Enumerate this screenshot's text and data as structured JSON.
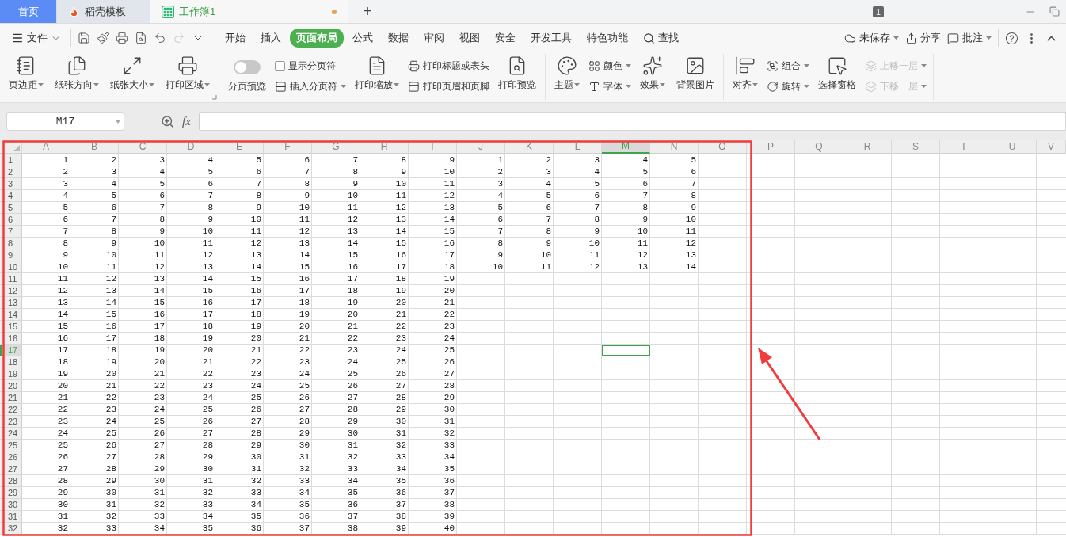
{
  "title_bar": {
    "tabs": [
      {
        "kind": "home",
        "label": "首页",
        "selected": false
      },
      {
        "kind": "docer",
        "label": "稻壳模板",
        "selected": false
      },
      {
        "kind": "sheet",
        "label": "工作簿1",
        "selected": true,
        "unsaved": true
      }
    ],
    "new_tab": "+",
    "window_count": "1"
  },
  "menu_bar": {
    "file_menu": "文件",
    "quick_actions": [
      {
        "disabled": false
      },
      {
        "disabled": false
      },
      {
        "disabled": false
      },
      {
        "disabled": false
      },
      {
        "disabled": false
      },
      {
        "disabled": true
      },
      {
        "disabled": false
      }
    ],
    "tabs": [
      {
        "label": "开始",
        "selected": false
      },
      {
        "label": "插入",
        "selected": false
      },
      {
        "label": "页面布局",
        "selected": true
      },
      {
        "label": "公式",
        "selected": false
      },
      {
        "label": "数据",
        "selected": false
      },
      {
        "label": "审阅",
        "selected": false
      },
      {
        "label": "视图",
        "selected": false
      },
      {
        "label": "安全",
        "selected": false
      },
      {
        "label": "开发工具",
        "selected": false
      },
      {
        "label": "特色功能",
        "selected": false
      }
    ],
    "search": "查找",
    "right_actions": [
      {
        "label": "未保存",
        "dropdown": true
      },
      {
        "label": "分享",
        "dropdown": false
      },
      {
        "label": "批注",
        "dropdown": true
      }
    ]
  },
  "ribbon": {
    "groups": [
      {
        "items": [
          {
            "kind": "large",
            "label": "页边距",
            "dropdown": true
          },
          {
            "kind": "large",
            "label": "纸张方向",
            "dropdown": true
          },
          {
            "kind": "large",
            "label": "纸张大小",
            "dropdown": true
          },
          {
            "kind": "large",
            "label": "打印区域",
            "dropdown": true
          }
        ]
      },
      {
        "items": [
          {
            "kind": "toggle",
            "label": "分页预览",
            "on": false
          },
          {
            "kind": "stack",
            "items": [
              {
                "kind": "checkbox",
                "label": "显示分页符",
                "checked": false
              },
              {
                "kind": "small",
                "label": "插入分页符",
                "dropdown": true,
                "disabled": false
              }
            ]
          },
          {
            "kind": "large",
            "label": "打印缩放",
            "dropdown": true
          },
          {
            "kind": "stack",
            "items": [
              {
                "kind": "small",
                "label": "打印标题或表头",
                "dropdown": false,
                "disabled": false
              },
              {
                "kind": "small",
                "label": "打印页眉和页脚",
                "dropdown": false,
                "disabled": false
              }
            ]
          },
          {
            "kind": "large",
            "label": "打印预览",
            "dropdown": false
          }
        ]
      },
      {
        "items": [
          {
            "kind": "large",
            "label": "主题",
            "dropdown": true
          },
          {
            "kind": "stack",
            "items": [
              {
                "kind": "small",
                "label": "颜色",
                "dropdown": true,
                "disabled": false
              },
              {
                "kind": "small",
                "label": "字体",
                "dropdown": true,
                "disabled": false
              }
            ]
          },
          {
            "kind": "large",
            "label": "效果",
            "dropdown": true
          },
          {
            "kind": "large",
            "label": "背景图片",
            "dropdown": false
          }
        ]
      },
      {
        "items": [
          {
            "kind": "large",
            "label": "对齐",
            "dropdown": true
          },
          {
            "kind": "stack",
            "items": [
              {
                "kind": "small",
                "label": "组合",
                "dropdown": true,
                "disabled": false
              },
              {
                "kind": "small",
                "label": "旋转",
                "dropdown": true,
                "disabled": false
              }
            ]
          },
          {
            "kind": "large",
            "label": "选择窗格",
            "dropdown": false
          },
          {
            "kind": "stack",
            "items": [
              {
                "kind": "small",
                "label": "上移一层",
                "dropdown": true,
                "disabled": true
              },
              {
                "kind": "small",
                "label": "下移一层",
                "dropdown": true,
                "disabled": true
              }
            ]
          }
        ]
      }
    ]
  },
  "formula_bar": {
    "name_box": "M17",
    "fx": "fx"
  },
  "sheet": {
    "columns": [
      {
        "label": "A",
        "selected": false
      },
      {
        "label": "B",
        "selected": false
      },
      {
        "label": "C",
        "selected": false
      },
      {
        "label": "D",
        "selected": false
      },
      {
        "label": "E",
        "selected": false
      },
      {
        "label": "F",
        "selected": false
      },
      {
        "label": "G",
        "selected": false
      },
      {
        "label": "H",
        "selected": false
      },
      {
        "label": "I",
        "selected": false
      },
      {
        "label": "J",
        "selected": false
      },
      {
        "label": "K",
        "selected": false
      },
      {
        "label": "L",
        "selected": false
      },
      {
        "label": "M",
        "selected": true
      },
      {
        "label": "N",
        "selected": false
      },
      {
        "label": "O",
        "selected": false
      },
      {
        "label": "P",
        "selected": false
      },
      {
        "label": "Q",
        "selected": false
      },
      {
        "label": "R",
        "selected": false
      },
      {
        "label": "S",
        "selected": false
      },
      {
        "label": "T",
        "selected": false
      },
      {
        "label": "U",
        "selected": false
      },
      {
        "label": "V",
        "selected": false
      }
    ],
    "rows": [
      {
        "number": "1",
        "selected": false,
        "cells": [
          "1",
          "2",
          "3",
          "4",
          "5",
          "6",
          "7",
          "8",
          "9",
          "1",
          "2",
          "3",
          "4",
          "5"
        ]
      },
      {
        "number": "2",
        "selected": false,
        "cells": [
          "2",
          "3",
          "4",
          "5",
          "6",
          "7",
          "8",
          "9",
          "10",
          "2",
          "3",
          "4",
          "5",
          "6"
        ]
      },
      {
        "number": "3",
        "selected": false,
        "cells": [
          "3",
          "4",
          "5",
          "6",
          "7",
          "8",
          "9",
          "10",
          "11",
          "3",
          "4",
          "5",
          "6",
          "7"
        ]
      },
      {
        "number": "4",
        "selected": false,
        "cells": [
          "4",
          "5",
          "6",
          "7",
          "8",
          "9",
          "10",
          "11",
          "12",
          "4",
          "5",
          "6",
          "7",
          "8"
        ]
      },
      {
        "number": "5",
        "selected": false,
        "cells": [
          "5",
          "6",
          "7",
          "8",
          "9",
          "10",
          "11",
          "12",
          "13",
          "5",
          "6",
          "7",
          "8",
          "9"
        ]
      },
      {
        "number": "6",
        "selected": false,
        "cells": [
          "6",
          "7",
          "8",
          "9",
          "10",
          "11",
          "12",
          "13",
          "14",
          "6",
          "7",
          "8",
          "9",
          "10"
        ]
      },
      {
        "number": "7",
        "selected": false,
        "cells": [
          "7",
          "8",
          "9",
          "10",
          "11",
          "12",
          "13",
          "14",
          "15",
          "7",
          "8",
          "9",
          "10",
          "11"
        ]
      },
      {
        "number": "8",
        "selected": false,
        "cells": [
          "8",
          "9",
          "10",
          "11",
          "12",
          "13",
          "14",
          "15",
          "16",
          "8",
          "9",
          "10",
          "11",
          "12"
        ]
      },
      {
        "number": "9",
        "selected": false,
        "cells": [
          "9",
          "10",
          "11",
          "12",
          "13",
          "14",
          "15",
          "16",
          "17",
          "9",
          "10",
          "11",
          "12",
          "13"
        ]
      },
      {
        "number": "10",
        "selected": false,
        "cells": [
          "10",
          "11",
          "12",
          "13",
          "14",
          "15",
          "16",
          "17",
          "18",
          "10",
          "11",
          "12",
          "13",
          "14"
        ]
      },
      {
        "number": "11",
        "selected": false,
        "cells": [
          "11",
          "12",
          "13",
          "14",
          "15",
          "16",
          "17",
          "18",
          "19"
        ]
      },
      {
        "number": "12",
        "selected": false,
        "cells": [
          "12",
          "13",
          "14",
          "15",
          "16",
          "17",
          "18",
          "19",
          "20"
        ]
      },
      {
        "number": "13",
        "selected": false,
        "cells": [
          "13",
          "14",
          "15",
          "16",
          "17",
          "18",
          "19",
          "20",
          "21"
        ]
      },
      {
        "number": "14",
        "selected": false,
        "cells": [
          "14",
          "15",
          "16",
          "17",
          "18",
          "19",
          "20",
          "21",
          "22"
        ]
      },
      {
        "number": "15",
        "selected": false,
        "cells": [
          "15",
          "16",
          "17",
          "18",
          "19",
          "20",
          "21",
          "22",
          "23"
        ]
      },
      {
        "number": "16",
        "selected": false,
        "cells": [
          "16",
          "17",
          "18",
          "19",
          "20",
          "21",
          "22",
          "23",
          "24"
        ]
      },
      {
        "number": "17",
        "selected": true,
        "cells": [
          "17",
          "18",
          "19",
          "20",
          "21",
          "22",
          "23",
          "24",
          "25"
        ]
      },
      {
        "number": "18",
        "selected": false,
        "cells": [
          "18",
          "19",
          "20",
          "21",
          "22",
          "23",
          "24",
          "25",
          "26"
        ]
      },
      {
        "number": "19",
        "selected": false,
        "cells": [
          "19",
          "20",
          "21",
          "22",
          "23",
          "24",
          "25",
          "26",
          "27"
        ]
      },
      {
        "number": "20",
        "selected": false,
        "cells": [
          "20",
          "21",
          "22",
          "23",
          "24",
          "25",
          "26",
          "27",
          "28"
        ]
      },
      {
        "number": "21",
        "selected": false,
        "cells": [
          "21",
          "22",
          "23",
          "24",
          "25",
          "26",
          "27",
          "28",
          "29"
        ]
      },
      {
        "number": "22",
        "selected": false,
        "cells": [
          "22",
          "23",
          "24",
          "25",
          "26",
          "27",
          "28",
          "29",
          "30"
        ]
      },
      {
        "number": "23",
        "selected": false,
        "cells": [
          "23",
          "24",
          "25",
          "26",
          "27",
          "28",
          "29",
          "30",
          "31"
        ]
      },
      {
        "number": "24",
        "selected": false,
        "cells": [
          "24",
          "25",
          "26",
          "27",
          "28",
          "29",
          "30",
          "31",
          "32"
        ]
      },
      {
        "number": "25",
        "selected": false,
        "cells": [
          "25",
          "26",
          "27",
          "28",
          "29",
          "30",
          "31",
          "32",
          "33"
        ]
      },
      {
        "number": "26",
        "selected": false,
        "cells": [
          "26",
          "27",
          "28",
          "29",
          "30",
          "31",
          "32",
          "33",
          "34"
        ]
      },
      {
        "number": "27",
        "selected": false,
        "cells": [
          "27",
          "28",
          "29",
          "30",
          "31",
          "32",
          "33",
          "34",
          "35"
        ]
      },
      {
        "number": "28",
        "selected": false,
        "cells": [
          "28",
          "29",
          "30",
          "31",
          "32",
          "33",
          "34",
          "35",
          "36"
        ]
      },
      {
        "number": "29",
        "selected": false,
        "cells": [
          "29",
          "30",
          "31",
          "32",
          "33",
          "34",
          "35",
          "36",
          "37"
        ]
      },
      {
        "number": "30",
        "selected": false,
        "cells": [
          "30",
          "31",
          "32",
          "33",
          "34",
          "35",
          "36",
          "37",
          "38"
        ]
      },
      {
        "number": "31",
        "selected": false,
        "cells": [
          "31",
          "32",
          "33",
          "34",
          "35",
          "36",
          "37",
          "38",
          "39"
        ]
      },
      {
        "number": "32",
        "selected": false,
        "cells": [
          "32",
          "33",
          "34",
          "35",
          "36",
          "37",
          "38",
          "39",
          "40"
        ]
      }
    ]
  },
  "annotation": {
    "kind": "box-and-arrow"
  }
}
